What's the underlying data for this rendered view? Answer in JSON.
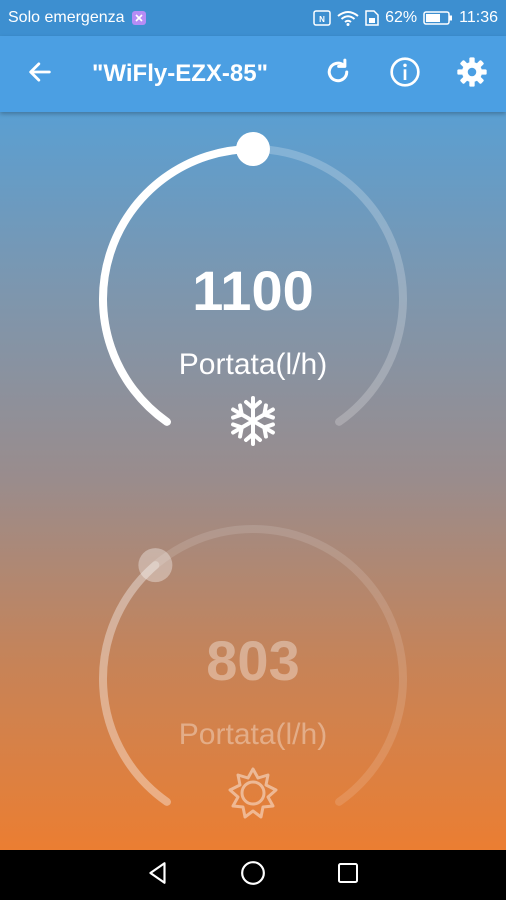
{
  "status_bar": {
    "carrier": "Solo emergenza",
    "battery_percent": "62%",
    "time": "11:36",
    "icons": [
      "notification-icon",
      "nfc-icon",
      "wifi-icon",
      "sim-icon",
      "battery-icon"
    ]
  },
  "app_bar": {
    "title": "\"WiFly-EZX-85\"",
    "icons": [
      "back-arrow-icon",
      "refresh-icon",
      "info-icon",
      "settings-gear-icon"
    ]
  },
  "cooling_dial": {
    "value": "1100",
    "label": "Portata(l/h)",
    "mode_icon": "snowflake-icon",
    "level_fraction": 0.5,
    "active": true
  },
  "heating_dial": {
    "value": "803",
    "label": "Portata(l/h)",
    "mode_icon": "sun-icon",
    "level_fraction": 0.36,
    "active": false
  },
  "nav_bar": {
    "icons": [
      "nav-back-icon",
      "nav-home-icon",
      "nav-recents-icon"
    ]
  },
  "colors": {
    "app_bar": "#4b9fe3",
    "status_bar": "#3d8fd0",
    "gradient_top": "#5a9fd2",
    "gradient_bottom": "#eb7e32"
  }
}
